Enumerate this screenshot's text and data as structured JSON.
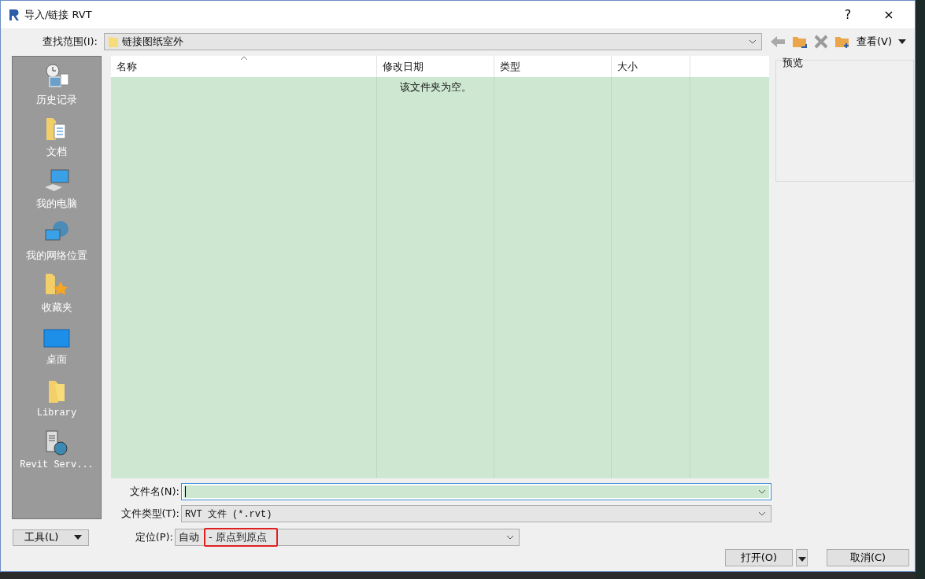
{
  "window": {
    "title": "导入/链接 RVT",
    "buttons": [
      "?",
      "×"
    ]
  },
  "look_in": {
    "label": "查找范围(I):",
    "value": "链接图纸室外"
  },
  "toolbar": {
    "view_label": "查看(V)"
  },
  "places": [
    {
      "label": "历史记录",
      "kind": "history"
    },
    {
      "label": "文档",
      "kind": "documents"
    },
    {
      "label": "我的电脑",
      "kind": "computer"
    },
    {
      "label": "我的网络位置",
      "kind": "network"
    },
    {
      "label": "收藏夹",
      "kind": "favorites"
    },
    {
      "label": "桌面",
      "kind": "desktop"
    },
    {
      "label": "Library",
      "kind": "folder"
    },
    {
      "label": "Revit Serv...",
      "kind": "server"
    }
  ],
  "file_list": {
    "columns": [
      {
        "label": "名称",
        "sorted": true
      },
      {
        "label": "修改日期",
        "sorted": false
      },
      {
        "label": "类型",
        "sorted": false
      },
      {
        "label": "大小",
        "sorted": false
      }
    ],
    "empty_message": "该文件夹为空。"
  },
  "preview": {
    "label": "预览"
  },
  "file_name": {
    "label": "文件名(N):"
  },
  "file_type": {
    "label": "文件类型(T):",
    "value": "RVT 文件 (*.rvt)"
  },
  "positioning": {
    "label": "定位(P):",
    "value": "自动",
    "highlighted_value": "- 原点到原点"
  },
  "tools_button": "工具(L)",
  "buttons": [
    "打开(O)",
    "取消(C)"
  ]
}
